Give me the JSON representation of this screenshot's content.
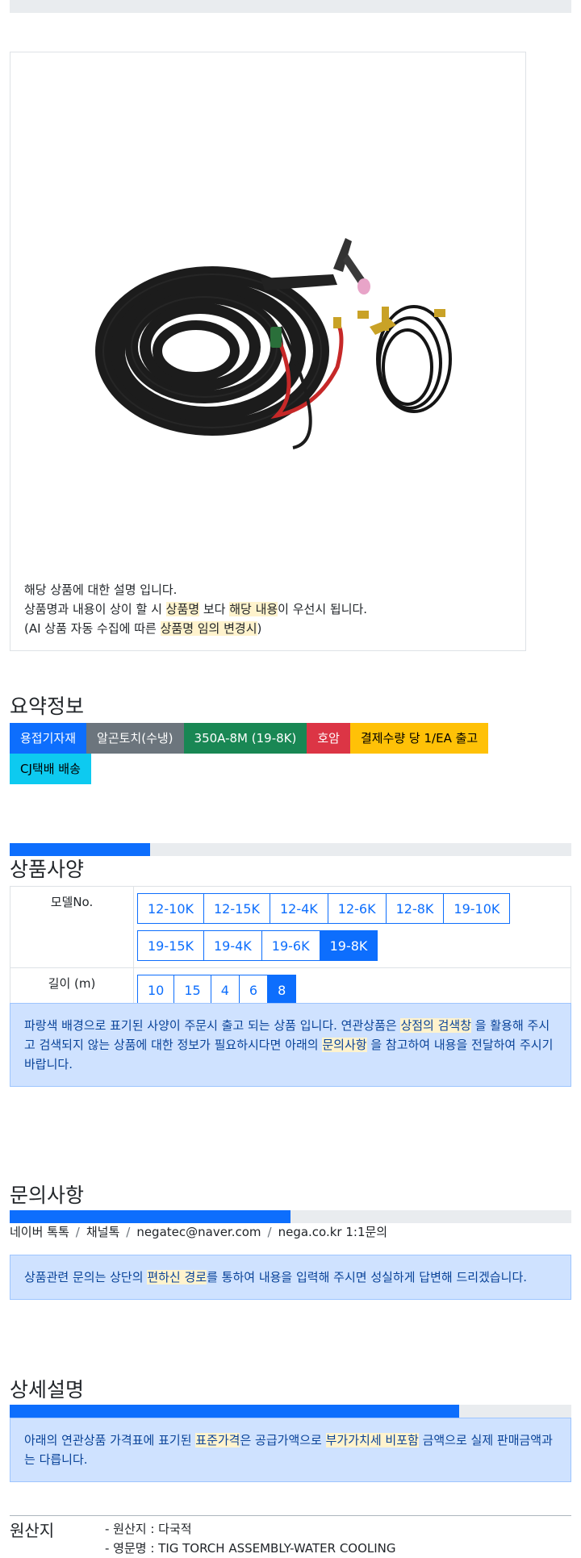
{
  "product": {
    "image_name": "tig-torch-image",
    "desc_line1": "해당 상품에 대한 설명 입니다.",
    "desc_line2_a": "상품명과 내용이 상이 할 시 ",
    "desc_line2_hl1": "상품명",
    "desc_line2_b": " 보다 ",
    "desc_line2_hl2": "해당 내용",
    "desc_line2_c": "이 우선시 됩니다.",
    "desc_line3_a": "(AI 상품 자동 수집에 따른 ",
    "desc_line3_hl": "상품명 임의 변경시",
    "desc_line3_b": ")"
  },
  "summary": {
    "title": "요약정보",
    "badges": [
      "용접기자재",
      "알곤토치(수냉)",
      "350A-8M (19-8K)",
      "호암",
      "결제수량 당 1/EA 출고",
      "CJ택배 배송"
    ]
  },
  "spec": {
    "title": "상품사양",
    "progress_fraction": 0.25,
    "model_label": "모델No.",
    "models": [
      "12-10K",
      "12-15K",
      "12-4K",
      "12-6K",
      "12-8K",
      "19-10K",
      "19-15K",
      "19-4K",
      "19-6K",
      "19-8K"
    ],
    "model_selected": "19-8K",
    "length_label": "길이 (m)",
    "lengths": [
      "10",
      "15",
      "4",
      "6",
      "8"
    ],
    "length_selected": "8",
    "notice_a": "파랑색 배경으로 표기된 사양이 주문시 출고 되는 상품 입니다. 연관상품은 ",
    "notice_hl1": "상점의 검색창",
    "notice_b": " 을 활용해 주시고 검색되지 않는 상품에 대한 정보가 필요하시다면 아래의 ",
    "notice_hl2": "문의사항",
    "notice_c": " 을 참고하여 내용을 전달하여 주시기 바랍니다."
  },
  "inquiry": {
    "title": "문의사항",
    "progress_fraction": 0.5,
    "links": [
      "네이버 톡톡",
      "채널톡",
      "negatec@naver.com",
      "nega.co.kr 1:1문의"
    ],
    "separator": "/",
    "notice_a": "상품관련 문의는 상단의 ",
    "notice_hl": "편하신 경로",
    "notice_b": "를 통하여 내용을 입력해 주시면 성실하게 답변해 드리겠습니다."
  },
  "detail": {
    "title": "상세설명",
    "progress_fraction": 0.8,
    "notice_a": "아래의 연관상품 가격표에 표기된 ",
    "notice_hl1": "표준가격",
    "notice_b": "은 공급가액으로 ",
    "notice_hl2": "부가가치세 비포함",
    "notice_c": " 금액으로 실제 판매금액과는 다릅니다."
  },
  "origin": {
    "label": "원산지",
    "line1": "- 원산지 : 다국적",
    "line2": "- 영문명 : TIG TORCH ASSEMBLY-WATER COOLING"
  },
  "colors": {
    "primary": "#0d6efd",
    "alert_bg": "#cfe2ff",
    "highlight": "#fff3cd"
  }
}
